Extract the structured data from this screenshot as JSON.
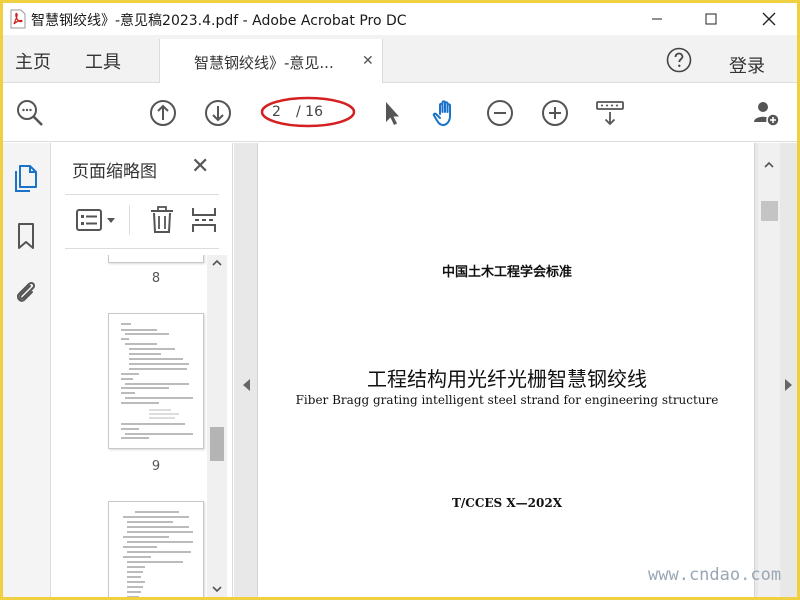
{
  "window": {
    "title": "智慧钢绞线》-意见稿2023.4.pdf - Adobe Acrobat Pro DC",
    "frame_color": "#f0d040"
  },
  "menu": {
    "home": "主页",
    "tools": "工具",
    "tab_label": "智慧钢绞线》-意见...",
    "login": "登录"
  },
  "toolbar": {
    "current_page": "2",
    "total_pages": "/ 16",
    "accent": "#1a73c8",
    "annotation_color": "#d42020",
    "icons": [
      "zoom-out-icon",
      "page-up-icon",
      "page-down-icon",
      "select-pointer-icon",
      "hand-tool-icon",
      "zoom-minus-icon",
      "zoom-plus-icon",
      "scroll-mode-icon",
      "add-user-icon"
    ]
  },
  "panel": {
    "title": "页面缩略图",
    "thumbnails": [
      {
        "label": "8"
      },
      {
        "label": "9"
      }
    ]
  },
  "document": {
    "org": "中国土木工程学会标准",
    "title_cn": "工程结构用光纤光栅智慧钢绞线",
    "title_en": "Fiber Bragg grating intelligent steel strand for engineering structure",
    "code": "T/CCES X—202X"
  },
  "watermark": "www.cndao.com"
}
